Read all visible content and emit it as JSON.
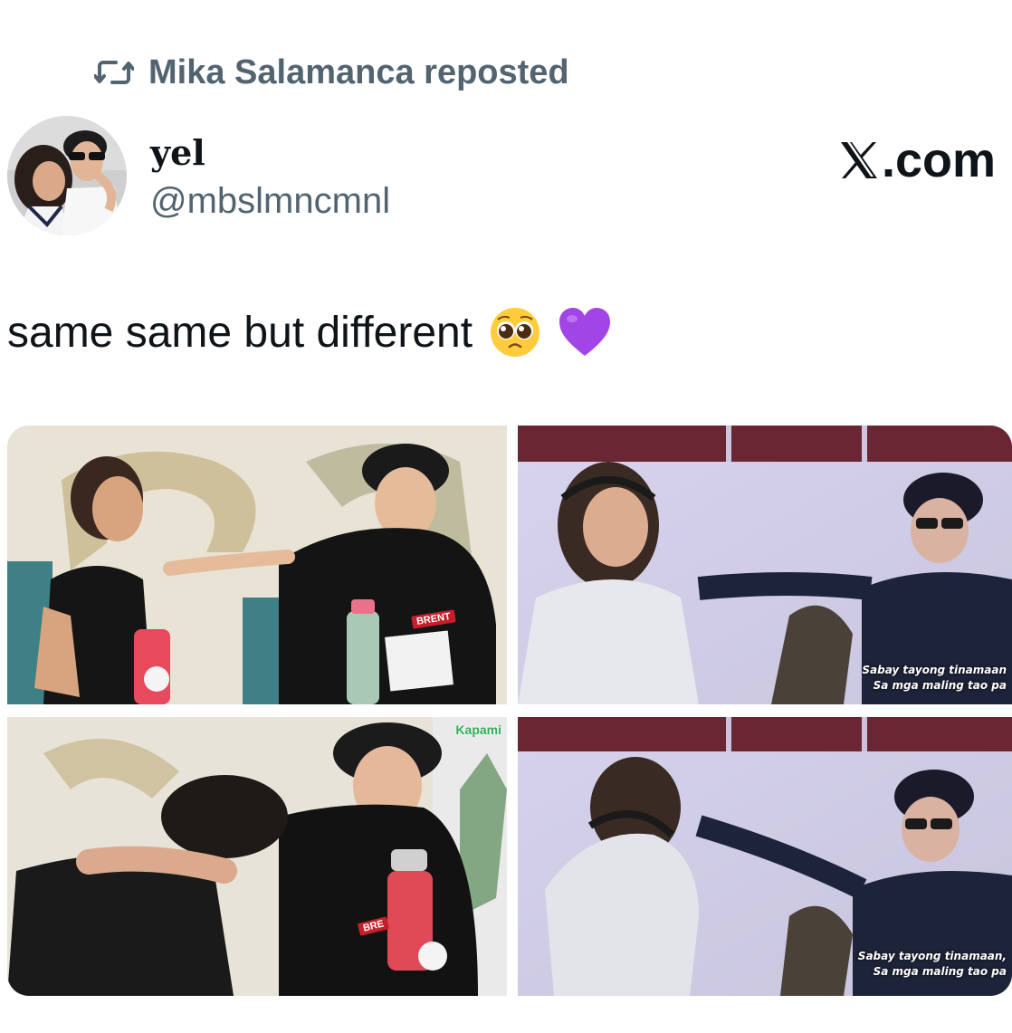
{
  "repost": {
    "label": "Mika Salamanca reposted",
    "icon": "repost-icon"
  },
  "author": {
    "name": "yel",
    "handle": "@mbslmncmnl"
  },
  "source": {
    "label": ".com",
    "icon": "x-logo-icon"
  },
  "tweet": {
    "text": "same same but different",
    "emojis": [
      "pleading-face-icon",
      "purple-heart-icon"
    ]
  },
  "media": {
    "top_left": {
      "name_tag": "BRENT"
    },
    "top_right": {
      "subtitle_line1": "Sabay tayong tinamaan",
      "subtitle_line2": "Sa mga maling tao pa"
    },
    "bottom_left": {
      "name_tag": "BRE",
      "logo": "Kapami"
    },
    "bottom_right": {
      "subtitle_line1": "Sabay tayong tinamaan,",
      "subtitle_line2": "Sa mga maling tao pa"
    }
  },
  "colors": {
    "text_primary": "#0f1419",
    "text_secondary": "#536471",
    "heart": "#a245e6"
  }
}
